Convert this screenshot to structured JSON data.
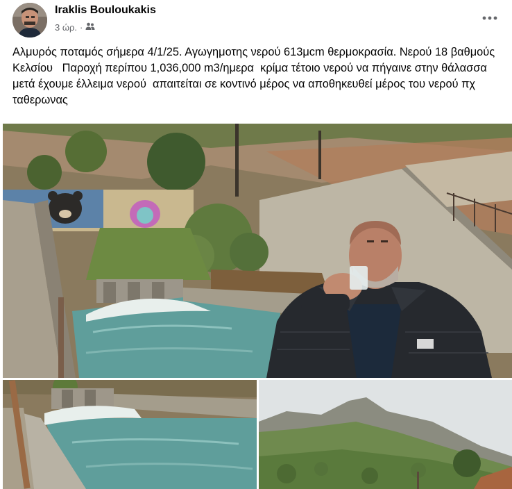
{
  "post": {
    "author": "Iraklis Bouloukakis",
    "time": "3 ώρ.",
    "separator": "·",
    "audience_icon": "friends-icon",
    "more_icon": "more-dots-icon",
    "text": "Αλμυρός ποταμός σήμερα 4/1/25. Αγωγημοτης νερού 613μcm θερμοκρασία. Νερού 18 βαθμούς Κελσίου   Παροχή περίπου 1,036,000 m3/ημερα  κρίμα τέτοιο νερού να πήγαινε στην θάλασσα μετά έχουμε έλλειμα νερού  απαιτείται σε κοντινό μέρος να αποθηκευθεί μέρος του νερού πχ ταθερωνας"
  },
  "photos": [
    {
      "name": "main",
      "description_icon": "river-man-drinking-photo"
    },
    {
      "name": "bottom-left",
      "description_icon": "river-channel-photo"
    },
    {
      "name": "bottom-right",
      "description_icon": "mountain-landscape-photo"
    }
  ],
  "colors": {
    "text": "#050505",
    "meta": "#65676b",
    "water": "#5f9e9b",
    "foam": "#e8efec",
    "rock": "#a48a6f",
    "concrete": "#b8b2a4",
    "vegetation": "#5d7a3a",
    "jacket": "#26292e",
    "sky": "#dfe3e4"
  }
}
